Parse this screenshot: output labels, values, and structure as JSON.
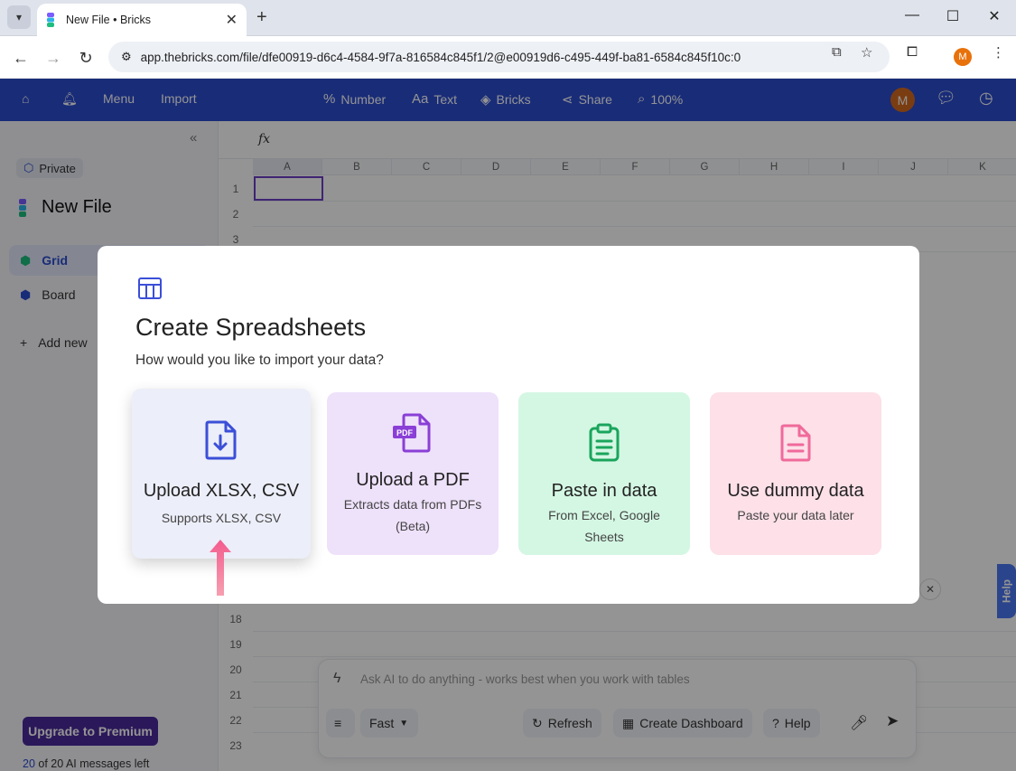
{
  "browser": {
    "tab_title": "New File • Bricks",
    "url": "app.thebricks.com/file/dfe00919-d6c4-4584-9f7a-816584c845f1/2@e00919d6-c495-449f-ba81-6584c845f10c:0",
    "profile_initial": "M"
  },
  "topnav": {
    "menu": "Menu",
    "import": "Import",
    "number": "Number",
    "text": "Text",
    "bricks": "Bricks",
    "share": "Share",
    "zoom": "100%",
    "avatar_initial": "M"
  },
  "sidebar": {
    "visibility": "Private",
    "file_name": "New File",
    "items": [
      {
        "label": "Grid"
      },
      {
        "label": "Board"
      },
      {
        "label": "Add new"
      }
    ],
    "upgrade_label": "Upgrade to Premium",
    "ai_used": "20",
    "ai_rest": " of 20 AI messages left"
  },
  "grid": {
    "columns": [
      "A",
      "B",
      "C",
      "D",
      "E",
      "F",
      "G",
      "H",
      "I",
      "J",
      "K"
    ],
    "rows": [
      "1",
      "2",
      "3",
      "18",
      "19",
      "20",
      "21",
      "22",
      "23"
    ]
  },
  "ai_panel": {
    "placeholder": "Ask AI to do anything - works best when you work with tables",
    "mode": "Fast",
    "refresh": "Refresh",
    "create_dashboard": "Create Dashboard",
    "help": "Help"
  },
  "help_tab": "Help",
  "modal": {
    "title": "Create Spreadsheets",
    "subtitle": "How would you like to import your data?",
    "options": [
      {
        "title": "Upload XLSX, CSV",
        "subtitle": "Supports XLSX, CSV",
        "icon": "file-download-icon"
      },
      {
        "title": "Upload a PDF",
        "subtitle": "Extracts data from PDFs (Beta)",
        "icon": "pdf-file-icon"
      },
      {
        "title": "Paste in data",
        "subtitle": "From Excel, Google Sheets",
        "icon": "clipboard-icon"
      },
      {
        "title": "Use dummy data",
        "subtitle": "Paste your data later",
        "icon": "document-icon"
      }
    ],
    "colors": {
      "upload": "#3b4fd8",
      "pdf": "#8a3fd6",
      "paste": "#1aa55c",
      "dummy": "#f06a9a",
      "arrow": "#f35c8e"
    }
  }
}
